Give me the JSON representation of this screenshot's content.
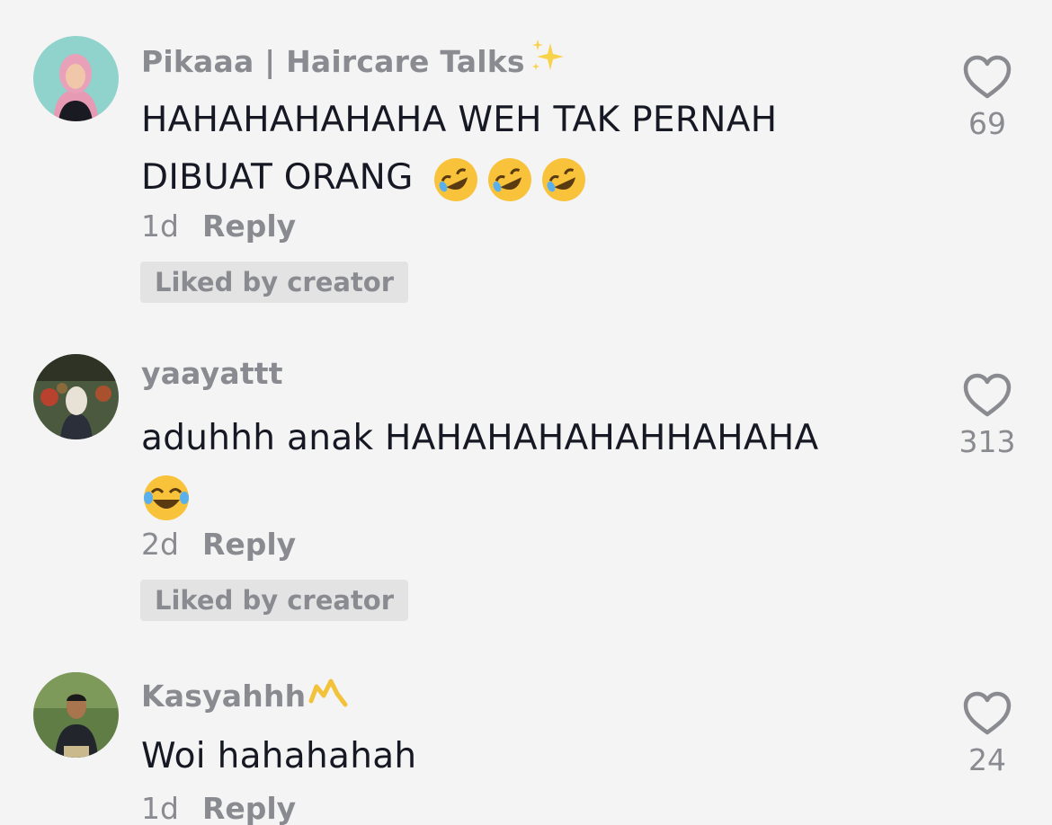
{
  "comments": [
    {
      "username": "Pikaaa | Haircare Talks",
      "username_icon": "sparkles-icon",
      "text_line1": "HAHAHAHAHAHA WEH TAK PERNAH",
      "text_line2": "DIBUAT ORANG",
      "emoji": "rolling-on-floor-laughing-icon",
      "time": "1d",
      "reply_label": "Reply",
      "liked_badge": "Liked by creator",
      "like_count": "69"
    },
    {
      "username": "yaayattt",
      "text_line1": "aduhhh anak HAHAHAHAHAHHAHAHA",
      "emoji": "face-with-tears-of-joy-icon",
      "time": "2d",
      "reply_label": "Reply",
      "liked_badge": "Liked by creator",
      "like_count": "313"
    },
    {
      "username": "Kasyahhh",
      "username_icon": "crown-icon",
      "text_line1": "Woi hahahahah",
      "time": "1d",
      "reply_label": "Reply",
      "like_count": "24"
    }
  ],
  "colors": {
    "background": "#f4f4f4",
    "text_primary": "#161823",
    "text_secondary": "#8a8b91",
    "badge_bg": "#e3e3e4"
  }
}
